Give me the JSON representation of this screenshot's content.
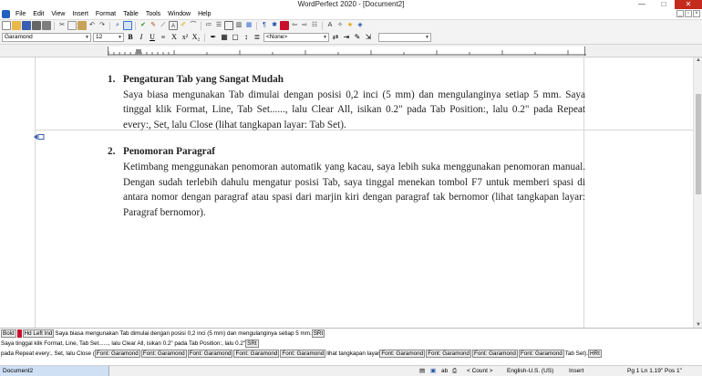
{
  "window": {
    "title": "WordPerfect 2020 - [Document2]",
    "controls": [
      "—",
      "□",
      "✕"
    ]
  },
  "menu": [
    "File",
    "Edit",
    "View",
    "Insert",
    "Format",
    "Table",
    "Tools",
    "Window",
    "Help"
  ],
  "property_bar": {
    "font": "Garamond",
    "size": "12",
    "style": "<None>"
  },
  "document": {
    "items": [
      {
        "number": "1.",
        "heading": "Pengaturan Tab yang Sangat Mudah",
        "body": "Saya biasa mengunakan Tab dimulai dengan posisi 0,2 inci (5 mm) dan mengulanginya setiap 5 mm. Saya tinggal klik Format, Line, Tab Set......, lalu Clear All, isikan 0.2\" pada Tab Position:, lalu 0.2\" pada Repeat every:, Set, lalu Close (lihat tangkapan layar: Tab Set)."
      },
      {
        "number": "2.",
        "heading": "Penomoran Paragraf",
        "body": "Ketimbang menggunakan penomoran automatik yang kacau, saya lebih suka menggunakan penomoran manual. Dengan sudah terlebih dahulu mengatur posisi Tab, saya tinggal menekan tombol F7 untuk memberi spasi di antara nomor dengan paragraf atau spasi dari marjin kiri dengan paragraf tak bernomor (lihat tangkapan layar: Paragraf bernomor)."
      }
    ]
  },
  "reveal_codes": {
    "line1": {
      "codes": [
        "Bold",
        "Hd Left Ind"
      ],
      "text": "Saya biasa mengunakan Tab dimulai dengan posisi 0,2 inci (5 mm) dan mengulanginya setiap 5 mm.",
      "end": "SRt"
    },
    "line2": {
      "text": "Saya tinggal klik Format, Line, Tab Set......, lalu Clear All, isikan 0.2\" pada Tab Position:, lalu 0.2\"",
      "end": "SRt"
    },
    "line3": {
      "t1": "pada Repeat every:, Set, lalu Close (",
      "c1": "Font: Garamond",
      "c2": "Font: Garamond",
      "c3": "Font: Garamond",
      "c4": "Font: Garamond",
      "c5": "Font: Garamond",
      "t2": "lihat tangkapan layar",
      "c6": "Font: Garamond",
      "c7": "Font: Garamond",
      "c8": "Font: Garamond",
      "c9": "Font: Garamond",
      "t3": "Tab Set).",
      "end": "HRt"
    }
  },
  "status": {
    "document_tab": "Document2",
    "count": "< Count >",
    "language": "English-U.S. (US)",
    "mode": "Insert",
    "position": "Pg 1 Ln 1.19\" Pos 1\""
  },
  "colors": {
    "close_button": "#c42b1c",
    "doc_tab": "#cfe0f5",
    "reveal_code_marker": "#c8102e"
  }
}
